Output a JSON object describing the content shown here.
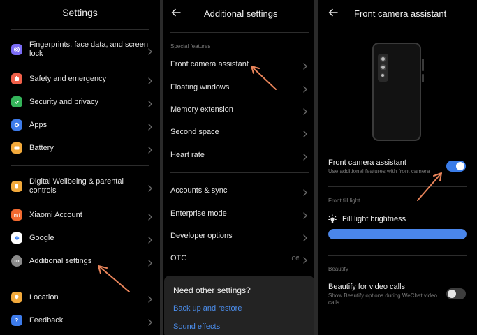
{
  "colors": {
    "accent": "#3a7ce8",
    "link": "#4c8fef",
    "arrow": "#e8845a"
  },
  "settings": {
    "title": "Settings",
    "groups": [
      [
        {
          "id": "fingerprints",
          "label": "Fingerprints, face data, and screen lock",
          "icon": "fingerprint-icon",
          "color": "#7b6cf6"
        },
        {
          "id": "safety",
          "label": "Safety and emergency",
          "icon": "emergency-icon",
          "color": "#f0604a"
        },
        {
          "id": "security",
          "label": "Security and privacy",
          "icon": "shield-check-icon",
          "color": "#34b45a"
        },
        {
          "id": "apps",
          "label": "Apps",
          "icon": "apps-icon",
          "color": "#3d7bea"
        },
        {
          "id": "battery",
          "label": "Battery",
          "icon": "battery-icon",
          "color": "#f2a93b"
        }
      ],
      [
        {
          "id": "wellbeing",
          "label": "Digital Wellbeing & parental controls",
          "icon": "wellbeing-icon",
          "color": "#f2a93b"
        },
        {
          "id": "xiaomi",
          "label": "Xiaomi Account",
          "icon": "xiaomi-icon",
          "color": "#f26a30"
        },
        {
          "id": "google",
          "label": "Google",
          "icon": "google-icon",
          "color": "#ffffff"
        },
        {
          "id": "additional",
          "label": "Additional settings",
          "icon": "more-dots-icon",
          "color": "#8a8a8a"
        }
      ],
      [
        {
          "id": "location",
          "label": "Location",
          "icon": "location-icon",
          "color": "#f2a93b"
        },
        {
          "id": "feedback",
          "label": "Feedback",
          "icon": "feedback-icon",
          "color": "#3d7bea"
        }
      ]
    ]
  },
  "additional": {
    "title": "Additional settings",
    "section_label": "Special features",
    "special_items": [
      {
        "label": "Front camera assistant"
      },
      {
        "label": "Floating windows"
      },
      {
        "label": "Memory extension"
      },
      {
        "label": "Second space"
      },
      {
        "label": "Heart rate"
      }
    ],
    "other_items": [
      {
        "label": "Accounts & sync"
      },
      {
        "label": "Enterprise mode"
      },
      {
        "label": "Developer options"
      },
      {
        "label": "OTG",
        "value": "Off"
      }
    ],
    "card": {
      "title": "Need other settings?",
      "links": [
        "Back up and restore",
        "Sound effects"
      ]
    }
  },
  "front_camera": {
    "title": "Front camera assistant",
    "toggle_title": "Front camera assistant",
    "toggle_subtitle": "Use additional features with front camera",
    "toggle_on": true,
    "fill_section_label": "Front fill light",
    "fill_label": "Fill light brightness",
    "fill_level": 1.0,
    "beautify_section_label": "Beautify",
    "beautify_title": "Beautify for video calls",
    "beautify_subtitle": "Show Beautify options during WeChat video calls",
    "beautify_on": false
  }
}
